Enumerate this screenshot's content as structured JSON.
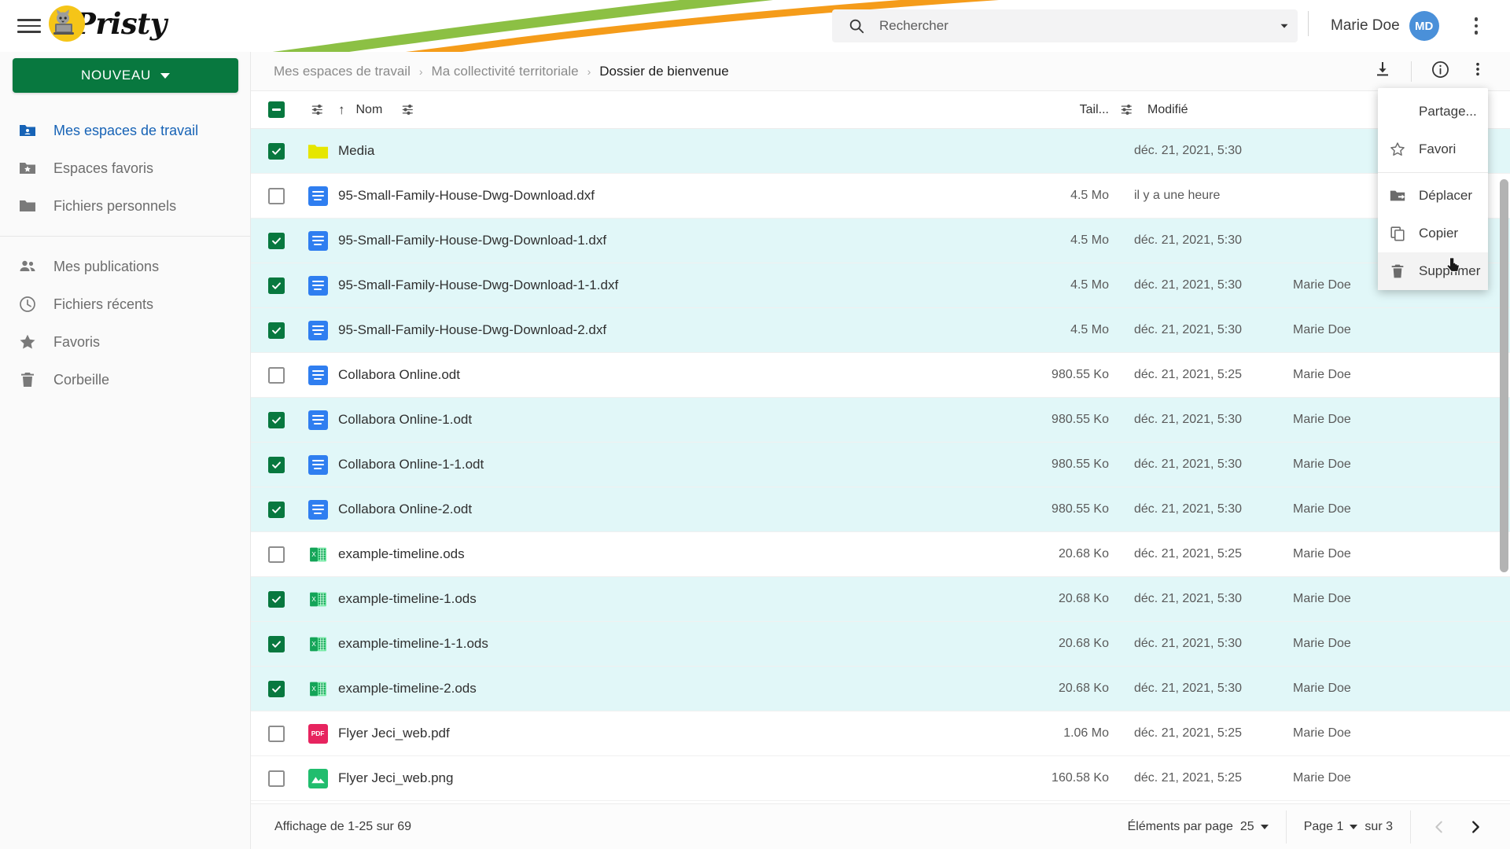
{
  "app": {
    "name": "Pristy",
    "logo_icon": "cat-laptop-logo",
    "menu_icon": "hamburger-menu-icon"
  },
  "topbar": {
    "search": {
      "placeholder": "Rechercher",
      "value": "",
      "icon": "search-icon",
      "caret_icon": "chevron-down-icon"
    },
    "user": {
      "name": "Marie Doe",
      "initials": "MD",
      "avatar_color": "#4a90d9"
    },
    "overflow_icon": "vertical-dots-icon"
  },
  "sidebar": {
    "new_button": {
      "label": "NOUVEAU",
      "caret_icon": "caret-down-icon",
      "color": "#08783f"
    },
    "items": [
      {
        "label": "Mes espaces de travail",
        "icon": "workspace-folder-icon",
        "active": true
      },
      {
        "label": "Espaces favoris",
        "icon": "star-folder-icon",
        "active": false
      },
      {
        "label": "Fichiers personnels",
        "icon": "folder-icon",
        "active": false
      },
      {
        "label": "Mes publications",
        "icon": "people-icon",
        "active": false
      },
      {
        "label": "Fichiers récents",
        "icon": "clock-icon",
        "active": false
      },
      {
        "label": "Favoris",
        "icon": "star-icon",
        "active": false
      },
      {
        "label": "Corbeille",
        "icon": "trash-icon",
        "active": false
      }
    ]
  },
  "breadcrumb": {
    "items": [
      "Mes espaces de travail",
      "Ma collectivité territoriale",
      "Dossier de bienvenue"
    ],
    "separator": "›",
    "actions": [
      {
        "name": "download-button",
        "icon": "download-icon"
      },
      {
        "name": "info-button",
        "icon": "info-circle-icon"
      },
      {
        "name": "more-button",
        "icon": "vertical-dots-icon"
      }
    ]
  },
  "table": {
    "header": {
      "select_all_state": "indeterminate",
      "filter_icon": "filter-settings-icon",
      "sort_icon": "sort-asc-arrow-icon",
      "columns": {
        "name": "Nom",
        "size": "Tail...",
        "modified": "Modifié",
        "modified_by": ""
      }
    },
    "rows": [
      {
        "selected": true,
        "icon": "folder-icon",
        "name": "Media",
        "size": "",
        "modified": "déc. 21, 2021, 5:30",
        "by": ""
      },
      {
        "selected": false,
        "icon": "document-icon",
        "name": "95-Small-Family-House-Dwg-Download.dxf",
        "size": "4.5 Mo",
        "modified": "il y a une heure",
        "by": ""
      },
      {
        "selected": true,
        "icon": "document-icon",
        "name": "95-Small-Family-House-Dwg-Download-1.dxf",
        "size": "4.5 Mo",
        "modified": "déc. 21, 2021, 5:30",
        "by": ""
      },
      {
        "selected": true,
        "icon": "document-icon",
        "name": "95-Small-Family-House-Dwg-Download-1-1.dxf",
        "size": "4.5 Mo",
        "modified": "déc. 21, 2021, 5:30",
        "by": "Marie Doe"
      },
      {
        "selected": true,
        "icon": "document-icon",
        "name": "95-Small-Family-House-Dwg-Download-2.dxf",
        "size": "4.5 Mo",
        "modified": "déc. 21, 2021, 5:30",
        "by": "Marie Doe"
      },
      {
        "selected": false,
        "icon": "document-icon",
        "name": "Collabora Online.odt",
        "size": "980.55 Ko",
        "modified": "déc. 21, 2021, 5:25",
        "by": "Marie Doe"
      },
      {
        "selected": true,
        "icon": "document-icon",
        "name": "Collabora Online-1.odt",
        "size": "980.55 Ko",
        "modified": "déc. 21, 2021, 5:30",
        "by": "Marie Doe"
      },
      {
        "selected": true,
        "icon": "document-icon",
        "name": "Collabora Online-1-1.odt",
        "size": "980.55 Ko",
        "modified": "déc. 21, 2021, 5:30",
        "by": "Marie Doe"
      },
      {
        "selected": true,
        "icon": "document-icon",
        "name": "Collabora Online-2.odt",
        "size": "980.55 Ko",
        "modified": "déc. 21, 2021, 5:30",
        "by": "Marie Doe"
      },
      {
        "selected": false,
        "icon": "spreadsheet-icon",
        "name": "example-timeline.ods",
        "size": "20.68 Ko",
        "modified": "déc. 21, 2021, 5:25",
        "by": "Marie Doe"
      },
      {
        "selected": true,
        "icon": "spreadsheet-icon",
        "name": "example-timeline-1.ods",
        "size": "20.68 Ko",
        "modified": "déc. 21, 2021, 5:30",
        "by": "Marie Doe"
      },
      {
        "selected": true,
        "icon": "spreadsheet-icon",
        "name": "example-timeline-1-1.ods",
        "size": "20.68 Ko",
        "modified": "déc. 21, 2021, 5:30",
        "by": "Marie Doe"
      },
      {
        "selected": true,
        "icon": "spreadsheet-icon",
        "name": "example-timeline-2.ods",
        "size": "20.68 Ko",
        "modified": "déc. 21, 2021, 5:30",
        "by": "Marie Doe"
      },
      {
        "selected": false,
        "icon": "pdf-icon",
        "name": "Flyer Jeci_web.pdf",
        "size": "1.06 Mo",
        "modified": "déc. 21, 2021, 5:25",
        "by": "Marie Doe"
      },
      {
        "selected": false,
        "icon": "image-icon",
        "name": "Flyer Jeci_web.png",
        "size": "160.58 Ko",
        "modified": "déc. 21, 2021, 5:25",
        "by": "Marie Doe"
      }
    ]
  },
  "footer": {
    "showing": "Affichage de 1-25 sur 69",
    "per_page_label": "Éléments par page",
    "per_page_value": "25",
    "page_label": "Page 1",
    "of_label": "sur 3",
    "prev_icon": "chevron-left-icon",
    "next_icon": "chevron-right-icon"
  },
  "context_menu": {
    "items": [
      {
        "label": "Partage...",
        "icon": "",
        "hover": false
      },
      {
        "label": "Favori",
        "icon": "star-outline-icon",
        "hover": false
      },
      {
        "label": "Déplacer",
        "icon": "move-folder-icon",
        "hover": false
      },
      {
        "label": "Copier",
        "icon": "copy-icon",
        "hover": false
      },
      {
        "label": "Supprimer",
        "icon": "trash-icon",
        "hover": true
      }
    ]
  },
  "colors": {
    "brand_green": "#08783f",
    "selection": "#e1f7f8",
    "accent_blue": "#1763b6",
    "swoosh_green": "#8cc044",
    "swoosh_orange": "#f59c1a"
  }
}
